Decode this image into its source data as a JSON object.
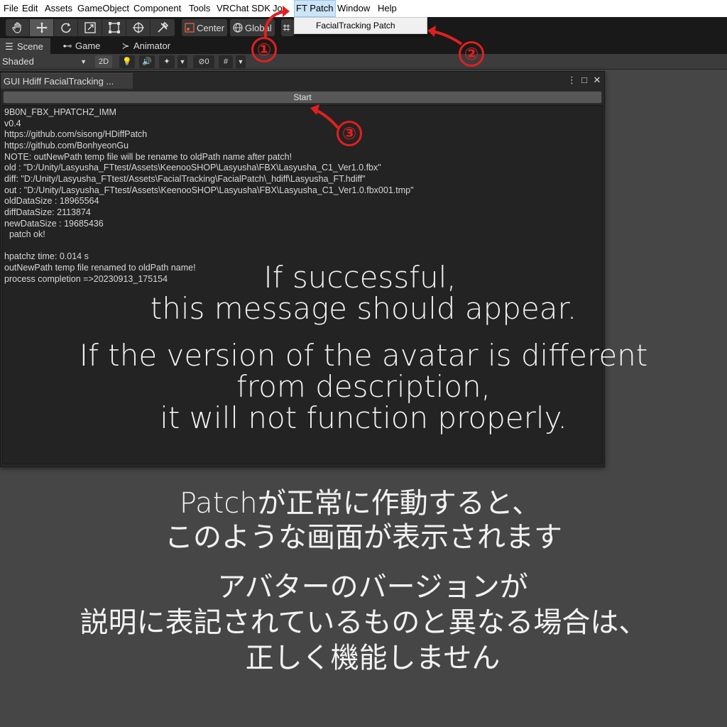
{
  "menubar": {
    "items": [
      "File",
      "Edit",
      "Assets",
      "GameObject",
      "Component",
      "Tools",
      "VRChat SDK",
      "Jo",
      "FT Patch",
      "Window",
      "Help"
    ],
    "active": "FT Patch"
  },
  "dropdown": {
    "item": "FacialTracking Patch"
  },
  "toolbar": {
    "tools": [
      "hand-icon",
      "move-icon",
      "rotate-icon",
      "scale-icon",
      "rect-icon",
      "transform-icon",
      "custom-tool-icon"
    ],
    "pivot_label": "Center",
    "space_label": "Global"
  },
  "tabs": [
    {
      "label": "Scene",
      "icon": "grid-icon"
    },
    {
      "label": "Game",
      "icon": "gamepad-icon"
    },
    {
      "label": "Animator",
      "icon": "animator-icon"
    }
  ],
  "scenebar": {
    "shading": "Shaded",
    "mode_2d": "2D",
    "hidden_count": "0"
  },
  "window": {
    "title": "GUI Hdiff FacialTracking ...",
    "start_label": "Start",
    "log": [
      "9B0N_FBX_HPATCHZ_IMM",
      "v0.4",
      "https://github.com/sisong/HDiffPatch",
      "https://github.com/BonhyeonGu",
      "NOTE: outNewPath temp file will be rename to oldPath name after patch!",
      "old : \"D:/Unity/Lasyusha_FTtest/Assets\\KeenooSHOP\\Lasyusha\\FBX\\Lasyusha_C1_Ver1.0.fbx\"",
      "diff: \"D:/Unity/Lasyusha_FTtest/Assets\\FacialTracking\\FacialPatch\\_hdiff\\Lasyusha_FT.hdiff\"",
      "out : \"D:/Unity/Lasyusha_FTtest/Assets\\KeenooSHOP\\Lasyusha\\FBX\\Lasyusha_C1_Ver1.0.fbx001.tmp\"",
      "oldDataSize : 18965564",
      "diffDataSize: 2113874",
      "newDataSize : 19685436",
      "  patch ok!",
      "",
      "hpatchz time: 0.014 s",
      "outNewPath temp file renamed to oldPath name!",
      "process completion =>20230913_175154"
    ]
  },
  "overlay_en": {
    "line1": "If successful,",
    "line2": "this message should appear.",
    "line3": "If the version of the avatar is different",
    "line4": "from description,",
    "line5": "it will not function properly."
  },
  "overlay_jp": {
    "line1": "Patchが正常に作動すると、",
    "line2": "このような画面が表示されます",
    "line3": "アバターのバージョンが",
    "line4": "説明に表記されているものと異なる場合は、",
    "line5": "正しく機能しません"
  },
  "markers": [
    "①",
    "②",
    "③"
  ],
  "colors": {
    "annotation": "#e02020",
    "menu_active": "#cce4f7",
    "editor_bg": "#282828",
    "page_bg": "#464646"
  }
}
